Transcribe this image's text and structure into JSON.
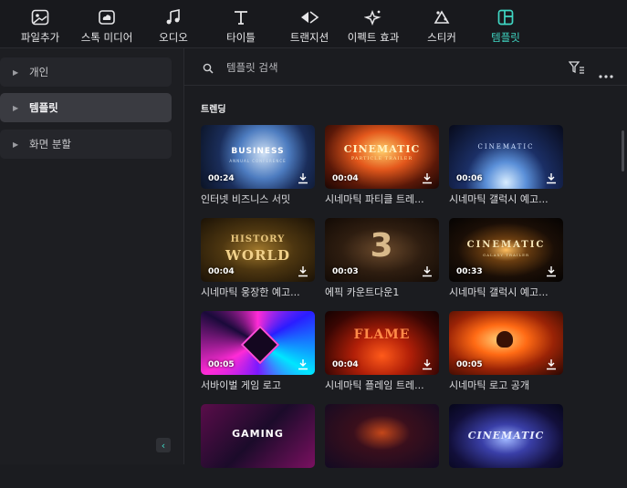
{
  "tabs": [
    {
      "label": "파일추가",
      "icon": "media-icon"
    },
    {
      "label": "스톡 미디어",
      "icon": "cloud-icon"
    },
    {
      "label": "오디오",
      "icon": "music-icon"
    },
    {
      "label": "타이틀",
      "icon": "text-icon"
    },
    {
      "label": "트랜지션",
      "icon": "transition-icon"
    },
    {
      "label": "이펙트 효과",
      "icon": "effects-icon"
    },
    {
      "label": "스티커",
      "icon": "sticker-icon"
    },
    {
      "label": "템플릿",
      "icon": "template-icon",
      "active": true
    }
  ],
  "sidebar": {
    "items": [
      {
        "label": "개인"
      },
      {
        "label": "템플릿",
        "active": true
      },
      {
        "label": "화면 분할"
      }
    ]
  },
  "search": {
    "placeholder": "템플릿 검색"
  },
  "section": {
    "title": "트렌딩"
  },
  "cards": [
    {
      "label": "인터넷 비즈니스 서밋",
      "duration": "00:24",
      "thumb_text": "BUSINESS",
      "thumb_sub": "ANNUAL CONFERENCE"
    },
    {
      "label": "시네마틱 파티클 트레...",
      "duration": "00:04",
      "thumb_text": "CINEMATIC",
      "thumb_sub": "PARTICLE TRAILER"
    },
    {
      "label": "시네마틱 갤럭시 예고...",
      "duration": "00:06",
      "thumb_text": "CINEMATIC",
      "thumb_sub": ""
    },
    {
      "label": "시네마틱 웅장한 예고...",
      "duration": "00:04",
      "thumb_text": "HISTORY",
      "thumb_sub": "WORLD"
    },
    {
      "label": "에픽 카운트다운1",
      "duration": "00:03",
      "thumb_text": "3",
      "thumb_sub": ""
    },
    {
      "label": "시네마틱 갤럭시 예고...",
      "duration": "00:33",
      "thumb_text": "CINEMATIC",
      "thumb_sub": "GALAXY TRAILER"
    },
    {
      "label": "서바이벌 게임 로고",
      "duration": "00:05",
      "thumb_text": "",
      "thumb_sub": ""
    },
    {
      "label": "시네마틱 플레임 트레...",
      "duration": "00:04",
      "thumb_text": "FLAME",
      "thumb_sub": ""
    },
    {
      "label": "시네마틱 로고 공개",
      "duration": "00:05",
      "thumb_text": "",
      "thumb_sub": ""
    },
    {
      "label": "",
      "duration": "",
      "thumb_text": "GAMING",
      "thumb_sub": ""
    },
    {
      "label": "",
      "duration": "",
      "thumb_text": "",
      "thumb_sub": ""
    },
    {
      "label": "",
      "duration": "",
      "thumb_text": "CINEMATIC",
      "thumb_sub": ""
    }
  ],
  "colors": {
    "accent": "#3fd7c4",
    "background": "#1b1c20",
    "sidebar_active": "#3a3b41"
  }
}
